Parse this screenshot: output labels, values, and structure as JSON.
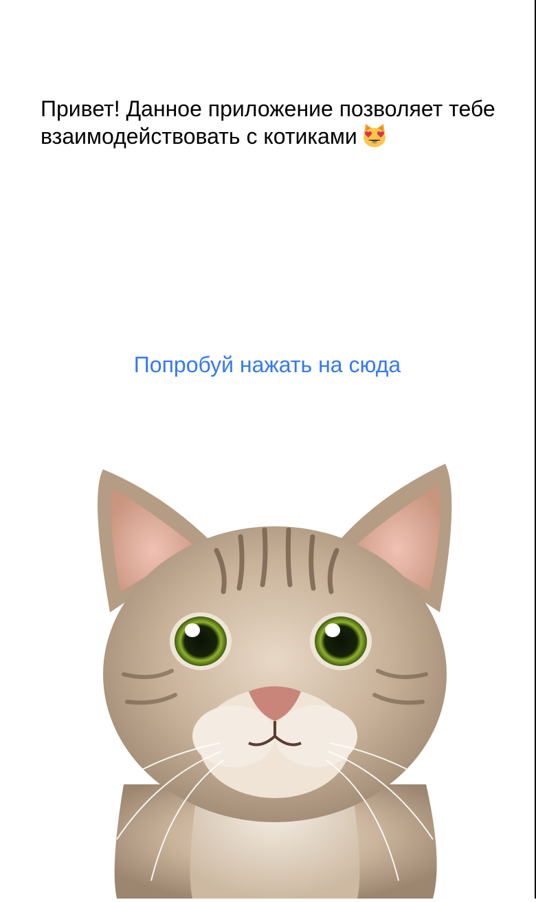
{
  "intro": {
    "text": "Привет! Данное приложение позволяет тебе взаимодействовать с котиками",
    "emoji_icon": "heart-eyes-cat-emoji"
  },
  "action": {
    "label": "Попробуй нажать на сюда"
  },
  "image": {
    "subject": "tabby-cat-photo"
  },
  "colors": {
    "link": "#3478f6",
    "text": "#000000",
    "background": "#ffffff"
  }
}
